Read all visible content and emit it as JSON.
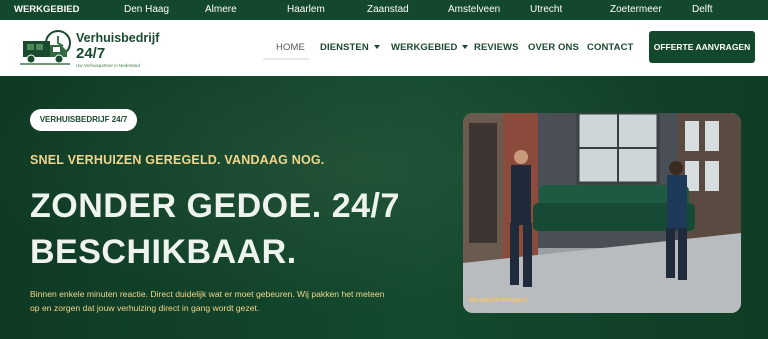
{
  "topbar": {
    "label": "WERKGEBIED",
    "cities": [
      "Den Haag",
      "Almere",
      "Haarlem",
      "Zaanstad",
      "Amstelveen",
      "Utrecht",
      "Zoetermeer",
      "Delft"
    ]
  },
  "logo": {
    "name": "Verhuisbedrijf",
    "number": "24/7",
    "tagline": "Uw Verhuispartner in Nederland"
  },
  "nav": {
    "home": "HOME",
    "diensten": "DIENSTEN",
    "werkgebied": "WERKGEBIED",
    "reviews": "REVIEWS",
    "over_ons": "OVER ONS",
    "contact": "CONTACT",
    "cta": "OFFERTE AANVRAGEN"
  },
  "hero": {
    "badge": "VERHUISBEDRIJF 24/7",
    "tagline": "SNEL VERHUIZEN GEREGELD. VANDAAG NOG.",
    "headline_line1": "ZONDER GEDOE. 24/7",
    "headline_line2": "BESCHIKBAAR.",
    "paragraph_line1": "Binnen enkele minuten reactie. Direct duidelijk wat er moet gebeuren. Wij pakken het meteen",
    "paragraph_line2": "op en zorgen dat jouw verhuizing direct in gang wordt gezet.",
    "image_caption": "Meubeltransport"
  },
  "colors": {
    "brand_green": "#14482c",
    "accent_yellow": "#f2d58a",
    "hero_background": "#0f3d25"
  }
}
